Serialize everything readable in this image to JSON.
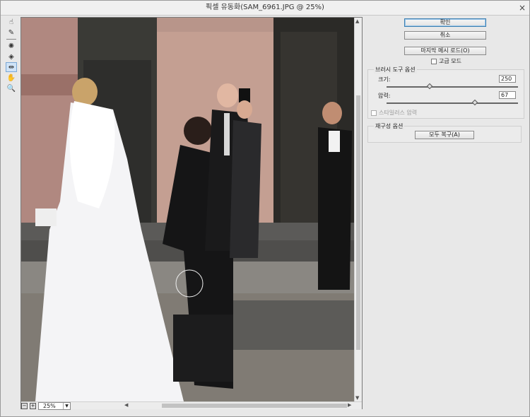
{
  "window": {
    "title": "픽셀 유동화(SAM_6961.JPG @ 25%)",
    "close_label": "×"
  },
  "tools": [
    {
      "name": "forward-warp-icon",
      "glyph": "☝"
    },
    {
      "name": "reconstruct-icon",
      "glyph": "✎"
    },
    {
      "name": "pucker-icon",
      "glyph": "✺"
    },
    {
      "name": "bloat-icon",
      "glyph": "◈"
    },
    {
      "name": "push-left-icon",
      "glyph": "⇹"
    },
    {
      "name": "hand-icon",
      "glyph": "✋"
    },
    {
      "name": "zoom-icon",
      "glyph": "🔍"
    }
  ],
  "panel": {
    "ok_label": "확인",
    "cancel_label": "취소",
    "load_last_mesh_label": "마지막 메시 로드(O)",
    "advanced_mode_label": "고급 모드",
    "brush_options": {
      "title": "브러시 도구 옵션",
      "size_label": "크기:",
      "size_value": "250",
      "size_level": 0.33,
      "pressure_label": "압력:",
      "pressure_value": "67",
      "pressure_level": 0.67,
      "stylus_label": "스타일러스 압력"
    },
    "reconstruct_options": {
      "title": "재구성 옵션",
      "restore_all_label": "모두 복구(A)"
    }
  },
  "zoom": {
    "value": "25%",
    "minus": "−",
    "plus": "+"
  },
  "colors": {
    "accent": "#3c7fb1"
  }
}
